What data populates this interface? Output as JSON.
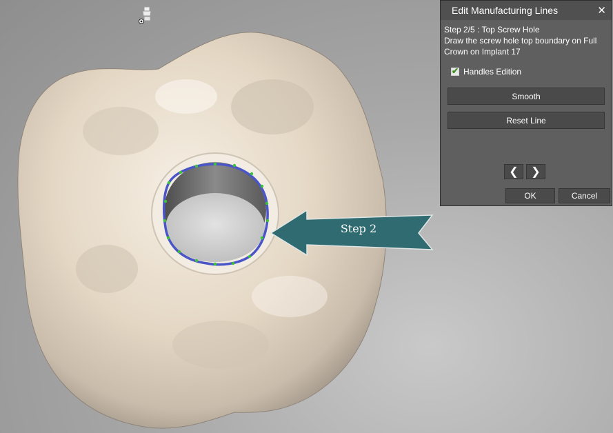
{
  "dialog": {
    "title": "Edit Manufacturing Lines",
    "step_title": "Step 2/5 : Top Screw Hole",
    "step_description": "Draw the screw hole top boundary on Full Crown on Implant 17",
    "handles_label": "Handles Edition",
    "handles_checked": true,
    "smooth_label": "Smooth",
    "reset_label": "Reset Line",
    "prev_glyph": "❮",
    "next_glyph": "❯",
    "ok_label": "OK",
    "cancel_label": "Cancel",
    "close_glyph": "✕"
  },
  "viewport": {
    "annotation_text": "Step 2",
    "annotation_color": "#2f6b70",
    "crown_color": "#e8dccb",
    "line_color": "#4a55c8",
    "handle_color": "#3ec23a",
    "scan_icon": "scan-body-icon"
  }
}
